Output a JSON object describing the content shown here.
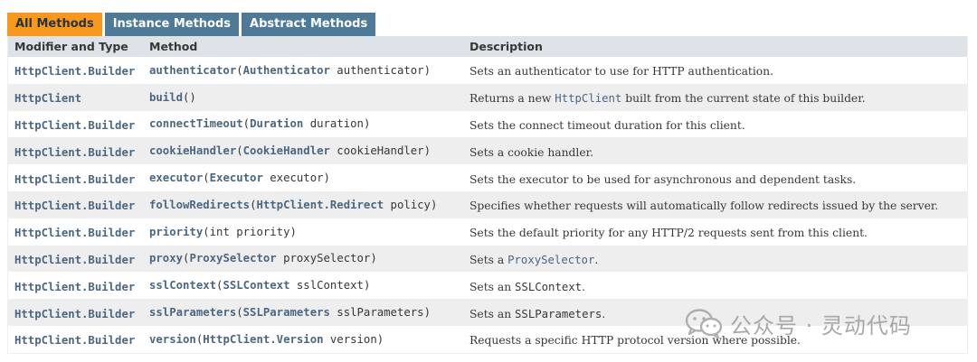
{
  "tabs": {
    "all": "All Methods",
    "instance": "Instance Methods",
    "abstract": "Abstract Methods"
  },
  "header": {
    "modifier": "Modifier and Type",
    "method": "Method",
    "description": "Description"
  },
  "rows": [
    {
      "type": "HttpClient.Builder",
      "method": "authenticator",
      "open": "(",
      "ptype": "Authenticator",
      "pname": " authenticator",
      "close": ")",
      "desc": "Sets an authenticator to use for HTTP authentication."
    },
    {
      "type": "HttpClient",
      "method": "build",
      "open": "()",
      "ptype": "",
      "pname": "",
      "close": "",
      "desc_pre": "Returns a new ",
      "desc_link": "HttpClient",
      "desc_post": " built from the current state of this builder."
    },
    {
      "type": "HttpClient.Builder",
      "method": "connectTimeout",
      "open": "(",
      "ptype": "Duration",
      "pname": " duration",
      "close": ")",
      "desc": "Sets the connect timeout duration for this client."
    },
    {
      "type": "HttpClient.Builder",
      "method": "cookieHandler",
      "open": "(",
      "ptype": "CookieHandler",
      "pname": " cookieHandler",
      "close": ")",
      "desc": "Sets a cookie handler."
    },
    {
      "type": "HttpClient.Builder",
      "method": "executor",
      "open": "(",
      "ptype": "Executor",
      "pname": " executor",
      "close": ")",
      "desc": "Sets the executor to be used for asynchronous and dependent tasks."
    },
    {
      "type": "HttpClient.Builder",
      "method": "followRedirects",
      "open": "(",
      "ptype": "HttpClient.Redirect",
      "pname": " policy",
      "close": ")",
      "desc": "Specifies whether requests will automatically follow redirects issued by the server."
    },
    {
      "type": "HttpClient.Builder",
      "method": "priority",
      "open": "(int priority)",
      "ptype": "",
      "pname": "",
      "close": "",
      "desc": "Sets the default priority for any HTTP/2 requests sent from this client."
    },
    {
      "type": "HttpClient.Builder",
      "method": "proxy",
      "open": "(",
      "ptype": "ProxySelector",
      "pname": " proxySelector",
      "close": ")",
      "desc_pre": "Sets a ",
      "desc_link": "ProxySelector",
      "desc_post": "."
    },
    {
      "type": "HttpClient.Builder",
      "method": "sslContext",
      "open": "(",
      "ptype": "SSLContext",
      "pname": " sslContext",
      "close": ")",
      "desc_pre": "Sets an ",
      "desc_code": "SSLContext",
      "desc_post": "."
    },
    {
      "type": "HttpClient.Builder",
      "method": "sslParameters",
      "open": "(",
      "ptype": "SSLParameters",
      "pname": " sslParameters",
      "close": ")",
      "desc_pre": "Sets an ",
      "desc_code": "SSLParameters",
      "desc_post": "."
    },
    {
      "type": "HttpClient.Builder",
      "method": "version",
      "open": "(",
      "ptype": "HttpClient.Version",
      "pname": " version",
      "close": ")",
      "desc": "Requests a specific HTTP protocol version where possible."
    }
  ],
  "watermark": {
    "text": "公众号 · 灵动代码",
    "icon": "wechat-icon"
  },
  "colors": {
    "tab_active": "#f8981d",
    "tab_inactive": "#4d7a97",
    "header_bg": "#dee3e9",
    "row_alt": "#eeeeef",
    "link": "#4a6782"
  }
}
